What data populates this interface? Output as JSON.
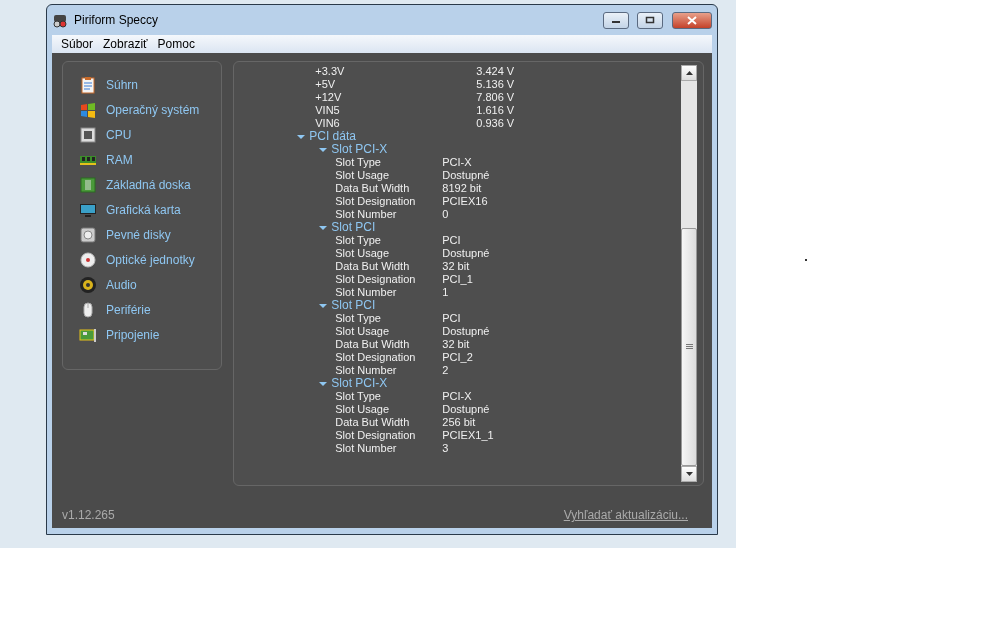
{
  "window": {
    "title": "Piriform Speccy"
  },
  "menu": [
    {
      "label": "Súbor"
    },
    {
      "label": "Zobraziť"
    },
    {
      "label": "Pomoc"
    }
  ],
  "sidebar": {
    "items": [
      {
        "label": "Súhrn",
        "selected": false
      },
      {
        "label": "Operačný systém",
        "selected": false
      },
      {
        "label": "CPU",
        "selected": false
      },
      {
        "label": "RAM",
        "selected": false
      },
      {
        "label": "Základná doska",
        "selected": false
      },
      {
        "label": "Grafická karta",
        "selected": false
      },
      {
        "label": "Pevné disky",
        "selected": false
      },
      {
        "label": "Optické jednotky",
        "selected": false
      },
      {
        "label": "Audio",
        "selected": false
      },
      {
        "label": "Periférie",
        "selected": false
      },
      {
        "label": "Pripojenie",
        "selected": false
      }
    ]
  },
  "details": {
    "voltages": [
      {
        "name": "+3.3V",
        "value": "3.424 V"
      },
      {
        "name": "+5V",
        "value": "5.136 V"
      },
      {
        "name": "+12V",
        "value": "7.806 V"
      },
      {
        "name": "VIN5",
        "value": "1.616 V"
      },
      {
        "name": "VIN6",
        "value": "0.936 V"
      }
    ],
    "tree": {
      "label": "PCI dáta",
      "expanded": true,
      "children": [
        {
          "label": "Slot PCI-X",
          "expanded": true,
          "properties": [
            {
              "name": "Slot Type",
              "value": "PCI-X"
            },
            {
              "name": "Slot Usage",
              "value": "Dostupné"
            },
            {
              "name": "Data But Width",
              "value": "8192 bit"
            },
            {
              "name": "Slot Designation",
              "value": "PCIEX16"
            },
            {
              "name": "Slot Number",
              "value": "0"
            }
          ]
        },
        {
          "label": "Slot PCI",
          "expanded": true,
          "properties": [
            {
              "name": "Slot Type",
              "value": "PCI"
            },
            {
              "name": "Slot Usage",
              "value": "Dostupné"
            },
            {
              "name": "Data But Width",
              "value": "32 bit"
            },
            {
              "name": "Slot Designation",
              "value": "PCI_1"
            },
            {
              "name": "Slot Number",
              "value": "1"
            }
          ]
        },
        {
          "label": "Slot PCI",
          "expanded": true,
          "properties": [
            {
              "name": "Slot Type",
              "value": "PCI"
            },
            {
              "name": "Slot Usage",
              "value": "Dostupné"
            },
            {
              "name": "Data But Width",
              "value": "32 bit"
            },
            {
              "name": "Slot Designation",
              "value": "PCI_2"
            },
            {
              "name": "Slot Number",
              "value": "2"
            }
          ]
        },
        {
          "label": "Slot PCI-X",
          "expanded": true,
          "properties": [
            {
              "name": "Slot Type",
              "value": "PCI-X"
            },
            {
              "name": "Slot Usage",
              "value": "Dostupné"
            },
            {
              "name": "Data But Width",
              "value": "256 bit"
            },
            {
              "name": "Slot Designation",
              "value": "PCIEX1_1"
            },
            {
              "name": "Slot Number",
              "value": "3"
            }
          ]
        }
      ]
    }
  },
  "status_bar": {
    "version": "v1.12.265",
    "link": "Vyhľadať aktualizáciu..."
  }
}
